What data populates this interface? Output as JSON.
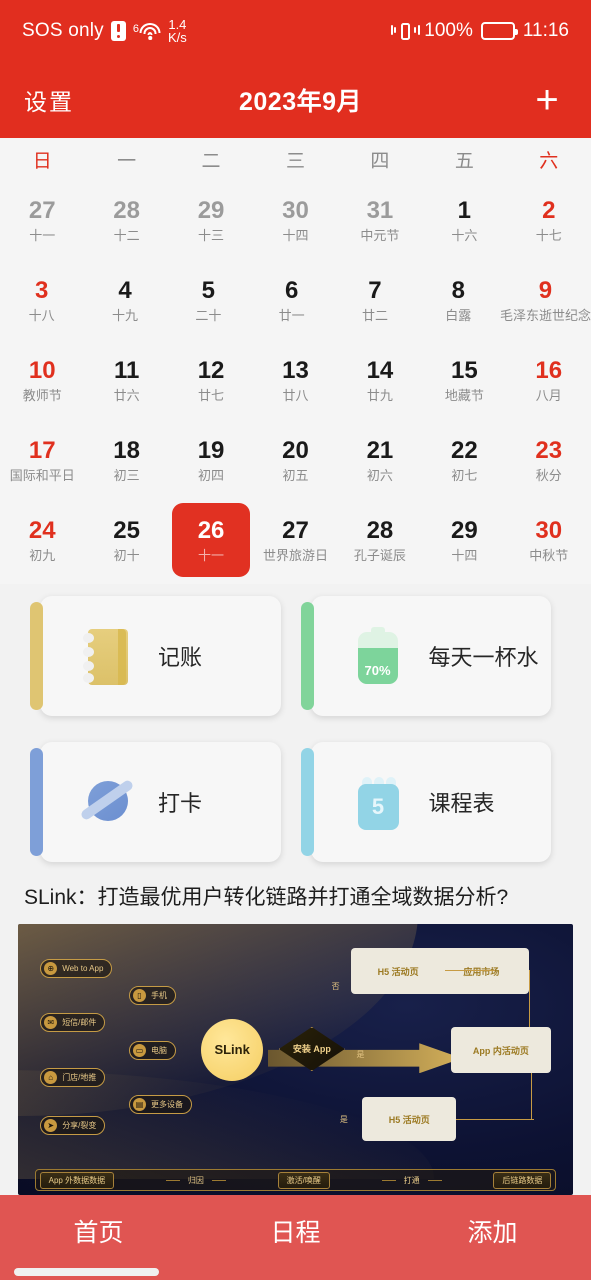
{
  "status_bar": {
    "carrier": "SOS only",
    "sim_icon": "sim-alert-icon",
    "wifi_generation": "6",
    "wifi_icon": "wifi-icon",
    "net_speed_value": "1.4",
    "net_speed_unit": "K/s",
    "vibrate_icon": "vibrate-icon",
    "battery_percent": "100%",
    "battery_icon": "battery-full-icon",
    "clock": "11:16"
  },
  "title_bar": {
    "settings_label": "设置",
    "month_title": "2023年9月",
    "add_label": "+"
  },
  "calendar": {
    "weekdays": [
      {
        "label": "日",
        "weekend": true
      },
      {
        "label": "一",
        "weekend": false
      },
      {
        "label": "二",
        "weekend": false
      },
      {
        "label": "三",
        "weekend": false
      },
      {
        "label": "四",
        "weekend": false
      },
      {
        "label": "五",
        "weekend": false
      },
      {
        "label": "六",
        "weekend": true
      }
    ],
    "weeks": [
      [
        {
          "day": "27",
          "sub": "十一",
          "style": "muted",
          "selected": false
        },
        {
          "day": "28",
          "sub": "十二",
          "style": "muted",
          "selected": false
        },
        {
          "day": "29",
          "sub": "十三",
          "style": "muted",
          "selected": false
        },
        {
          "day": "30",
          "sub": "十四",
          "style": "muted",
          "selected": false
        },
        {
          "day": "31",
          "sub": "中元节",
          "style": "muted",
          "selected": false
        },
        {
          "day": "1",
          "sub": "十六",
          "style": "normal",
          "selected": false
        },
        {
          "day": "2",
          "sub": "十七",
          "style": "red",
          "selected": false
        }
      ],
      [
        {
          "day": "3",
          "sub": "十八",
          "style": "red",
          "selected": false
        },
        {
          "day": "4",
          "sub": "十九",
          "style": "normal",
          "selected": false
        },
        {
          "day": "5",
          "sub": "二十",
          "style": "normal",
          "selected": false
        },
        {
          "day": "6",
          "sub": "廿一",
          "style": "normal",
          "selected": false
        },
        {
          "day": "7",
          "sub": "廿二",
          "style": "normal",
          "selected": false
        },
        {
          "day": "8",
          "sub": "白露",
          "style": "normal",
          "selected": false
        },
        {
          "day": "9",
          "sub": "毛泽东逝世纪念",
          "style": "red",
          "selected": false
        }
      ],
      [
        {
          "day": "10",
          "sub": "教师节",
          "style": "red",
          "selected": false
        },
        {
          "day": "11",
          "sub": "廿六",
          "style": "normal",
          "selected": false
        },
        {
          "day": "12",
          "sub": "廿七",
          "style": "normal",
          "selected": false
        },
        {
          "day": "13",
          "sub": "廿八",
          "style": "normal",
          "selected": false
        },
        {
          "day": "14",
          "sub": "廿九",
          "style": "normal",
          "selected": false
        },
        {
          "day": "15",
          "sub": "地藏节",
          "style": "normal",
          "selected": false
        },
        {
          "day": "16",
          "sub": "八月",
          "style": "red",
          "selected": false
        }
      ],
      [
        {
          "day": "17",
          "sub": "国际和平日",
          "style": "red",
          "selected": false
        },
        {
          "day": "18",
          "sub": "初三",
          "style": "normal",
          "selected": false
        },
        {
          "day": "19",
          "sub": "初四",
          "style": "normal",
          "selected": false
        },
        {
          "day": "20",
          "sub": "初五",
          "style": "normal",
          "selected": false
        },
        {
          "day": "21",
          "sub": "初六",
          "style": "normal",
          "selected": false
        },
        {
          "day": "22",
          "sub": "初七",
          "style": "normal",
          "selected": false
        },
        {
          "day": "23",
          "sub": "秋分",
          "style": "red",
          "selected": false
        }
      ],
      [
        {
          "day": "24",
          "sub": "初九",
          "style": "red",
          "selected": false
        },
        {
          "day": "25",
          "sub": "初十",
          "style": "normal",
          "selected": false
        },
        {
          "day": "26",
          "sub": "十一",
          "style": "normal",
          "selected": true
        },
        {
          "day": "27",
          "sub": "世界旅游日",
          "style": "normal",
          "selected": false
        },
        {
          "day": "28",
          "sub": "孔子诞辰",
          "style": "normal",
          "selected": false
        },
        {
          "day": "29",
          "sub": "十四",
          "style": "normal",
          "selected": false
        },
        {
          "day": "30",
          "sub": "中秋节",
          "style": "red",
          "selected": false
        }
      ]
    ]
  },
  "widgets": [
    {
      "label": "记账",
      "icon": "notebook-icon",
      "accent": "#DFC572"
    },
    {
      "label": "每天一杯水",
      "icon": "water-battery-icon",
      "accent": "#81D49A",
      "value": "70%"
    },
    {
      "label": "打卡",
      "icon": "planet-icon",
      "accent": "#7E9FD8"
    },
    {
      "label": "课程表",
      "icon": "calendar-number-icon",
      "accent": "#92D4E6",
      "value": "5"
    }
  ],
  "ad": {
    "title": "SLink：打造最优用户转化链路并打通全域数据分析?",
    "diagram": {
      "hub_label": "SLink",
      "decision_label": "安装 App",
      "source_pills": [
        "Web to App",
        "短信/邮件",
        "门店/地推",
        "分享/裂变"
      ],
      "device_pills": [
        "手机",
        "电脑",
        "更多设备"
      ],
      "nodes": [
        "H5 活动页",
        "应用市场",
        "App 内活动页",
        "H5 活动页"
      ],
      "branch_no": "否",
      "branch_yes_top": "是",
      "branch_yes_bottom": "是",
      "footer_chips": [
        "App 外数据数据",
        "激活/唤醒",
        "后链路数据"
      ],
      "footer_links": [
        "归因",
        "打通"
      ]
    }
  },
  "bottom_nav": [
    {
      "label": "首页",
      "active": true
    },
    {
      "label": "日程",
      "active": false
    },
    {
      "label": "添加",
      "active": false
    }
  ]
}
